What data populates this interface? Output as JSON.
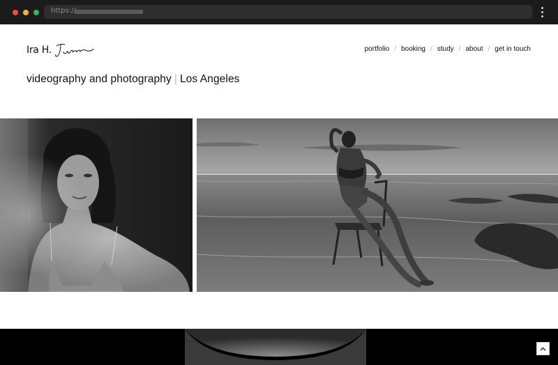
{
  "browser": {
    "url_prefix": "https://",
    "colors": {
      "close": "#ef4b48",
      "minimize": "#f2b53a",
      "maximize": "#36b45b"
    }
  },
  "site": {
    "logo_initials": "Ira H.",
    "logo_signature": "June",
    "nav": [
      "portfolio",
      "booking",
      "study",
      "about",
      "get in touch"
    ],
    "nav_separator": "/",
    "tagline_main": "videography and photography",
    "tagline_location": "Los Angeles"
  },
  "gallery": {
    "images": [
      {
        "subject": "black-and-white portrait of a woman in a lace bra"
      },
      {
        "subject": "black-and-white photo of a woman sitting on a chair in shallow ocean water"
      }
    ]
  },
  "icons": {
    "back_to_top": "chevron-up-icon",
    "menu": "kebab-menu-icon"
  }
}
